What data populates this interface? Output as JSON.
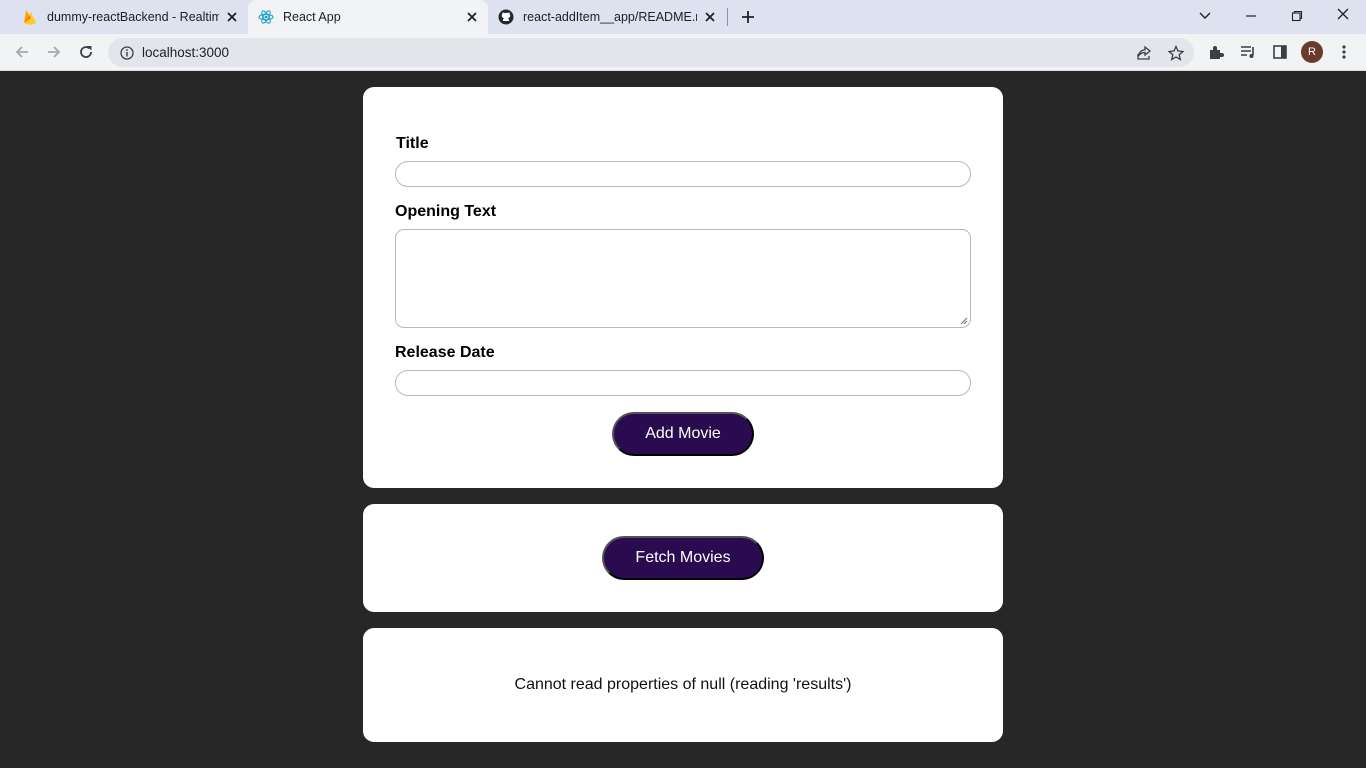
{
  "browser": {
    "tabs": [
      {
        "title": "dummy-reactBackend - Realtime",
        "icon": "firebase-icon",
        "active": false
      },
      {
        "title": "React App",
        "icon": "react-icon",
        "active": true
      },
      {
        "title": "react-addItem__app/README.md",
        "icon": "github-icon",
        "active": false
      }
    ],
    "url": "localhost:3000",
    "profile_initial": "R"
  },
  "form": {
    "title_label": "Title",
    "title_value": "",
    "opening_text_label": "Opening Text",
    "opening_text_value": "",
    "release_date_label": "Release Date",
    "release_date_value": "",
    "submit_label": "Add Movie"
  },
  "actions": {
    "fetch_label": "Fetch Movies"
  },
  "result": {
    "message": "Cannot read properties of null (reading 'results')"
  },
  "colors": {
    "page_background": "#272727",
    "button_background": "#2a0b4f"
  }
}
